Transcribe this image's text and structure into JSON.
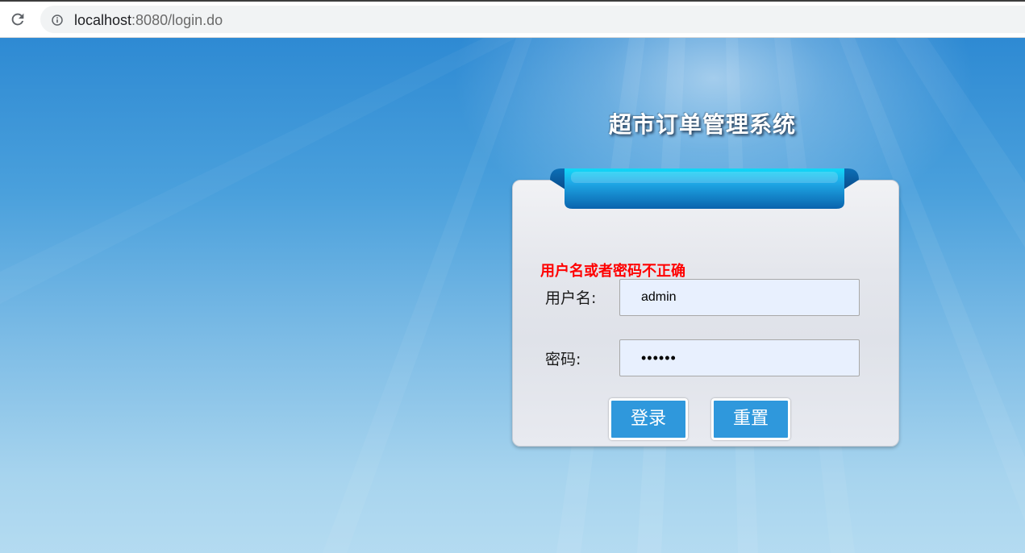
{
  "browser": {
    "url_host": "localhost",
    "url_rest": ":8080/login.do",
    "reload_icon": "reload-icon",
    "info_icon": "info-icon"
  },
  "login": {
    "title": "超市订单管理系统",
    "error_message": "用户名或者密码不正确",
    "username_label": "用户名:",
    "username_value": "admin",
    "password_label": "密码:",
    "password_value": "••••••",
    "login_button": "登录",
    "reset_button": "重置"
  },
  "colors": {
    "accent_button": "#2f98dc",
    "error_text": "#ff0000",
    "title_text": "#ffffff"
  }
}
